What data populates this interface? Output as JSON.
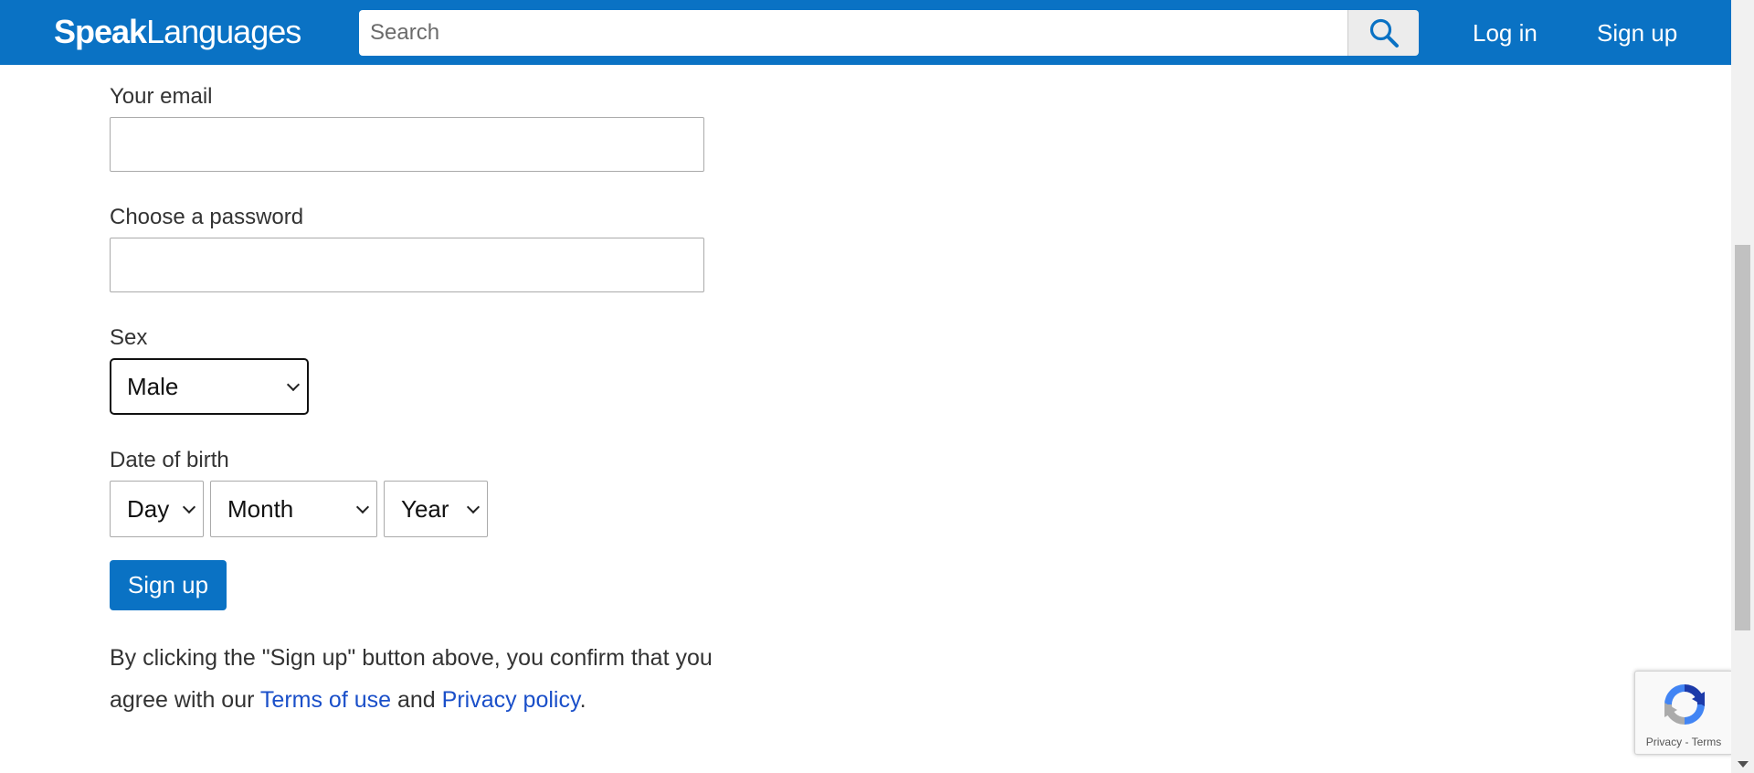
{
  "header": {
    "logo_bold": "Speak",
    "logo_light": "Languages",
    "search_placeholder": "Search",
    "search_icon": "magnifier-icon",
    "login_label": "Log in",
    "signup_label": "Sign up",
    "brand_color": "#0a72c4"
  },
  "form": {
    "email_label": "Your email",
    "email_value": "",
    "password_label": "Choose a password",
    "password_value": "",
    "sex_label": "Sex",
    "sex_selected": "Male",
    "dob_label": "Date of birth",
    "day_selected": "Day",
    "month_selected": "Month",
    "year_selected": "Year",
    "submit_label": "Sign up"
  },
  "legal": {
    "text_before": "By clicking the \"Sign up\" button above, you confirm that you agree with our ",
    "terms_link": "Terms of use",
    "and_text": " and ",
    "privacy_link": "Privacy policy",
    "end_text": "."
  },
  "recaptcha": {
    "privacy": "Privacy",
    "separator": " - ",
    "terms": "Terms",
    "icon": "recaptcha-icon"
  }
}
